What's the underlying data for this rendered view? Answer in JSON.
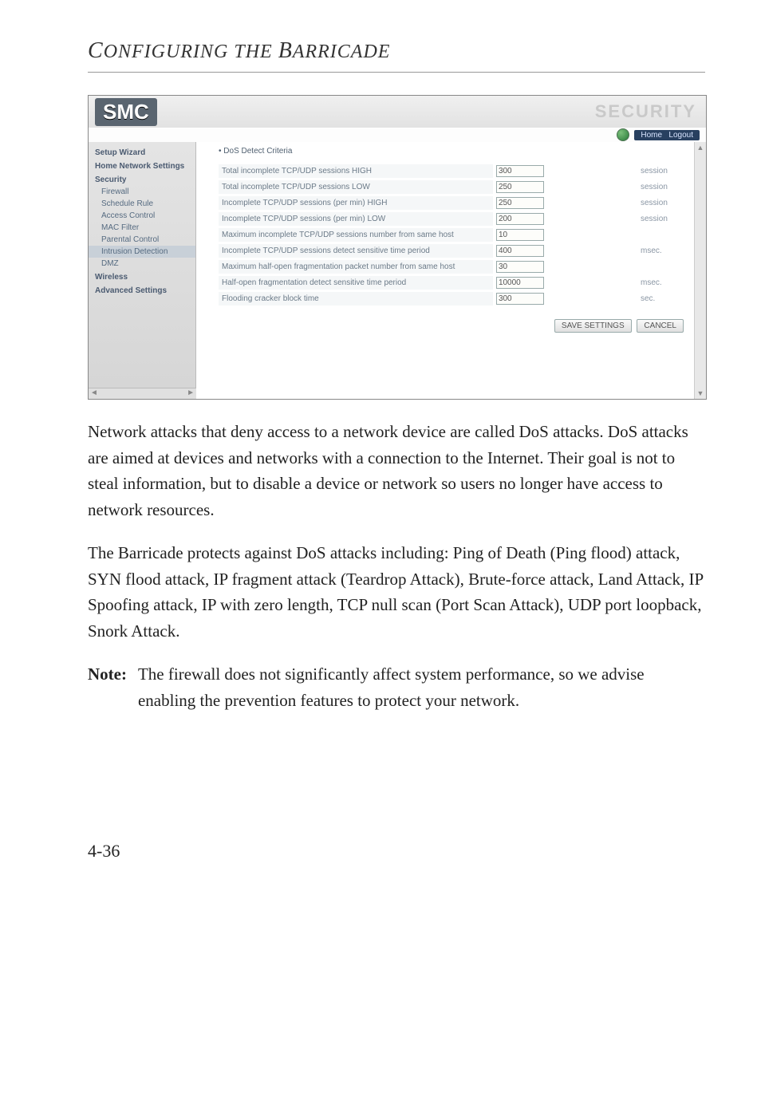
{
  "running_head": {
    "c1": "C",
    "w1": "ONFIGURING",
    "sp": " THE ",
    "c2": "B",
    "w2": "ARRICADE"
  },
  "screenshot": {
    "logo": "SMC",
    "security_word": "SECURITY",
    "nav_home": "Home",
    "nav_logout": "Logout",
    "sidebar": {
      "setup_wizard": "Setup Wizard",
      "home_network": "Home Network Settings",
      "security": "Security",
      "firewall": "Firewall",
      "schedule_rule": "Schedule Rule",
      "access_control": "Access Control",
      "mac_filter": "MAC Filter",
      "parental_control": "Parental Control",
      "intrusion_detection": "Intrusion Detection",
      "dmz": "DMZ",
      "wireless": "Wireless",
      "advanced_settings": "Advanced Settings"
    },
    "main_heading": "DoS Detect Criteria",
    "rows": [
      {
        "label": "Total incomplete TCP/UDP sessions HIGH",
        "value": "300",
        "unit": "session"
      },
      {
        "label": "Total incomplete TCP/UDP sessions LOW",
        "value": "250",
        "unit": "session"
      },
      {
        "label": "Incomplete TCP/UDP sessions (per min) HIGH",
        "value": "250",
        "unit": "session"
      },
      {
        "label": "Incomplete TCP/UDP sessions (per min) LOW",
        "value": "200",
        "unit": "session"
      },
      {
        "label": "Maximum incomplete TCP/UDP sessions number from same host",
        "value": "10",
        "unit": ""
      },
      {
        "label": "Incomplete TCP/UDP sessions detect sensitive time period",
        "value": "400",
        "unit": "msec."
      },
      {
        "label": "Maximum half-open fragmentation packet number from same host",
        "value": "30",
        "unit": ""
      },
      {
        "label": "Half-open fragmentation detect sensitive time period",
        "value": "10000",
        "unit": "msec."
      },
      {
        "label": "Flooding cracker block time",
        "value": "300",
        "unit": "sec."
      }
    ],
    "save_button": "SAVE SETTINGS",
    "cancel_button": "CANCEL"
  },
  "para1": "Network attacks that deny access to a network device are called DoS attacks. DoS attacks are aimed at devices and networks with a connection to the Internet. Their goal is not to steal information, but to disable a device or network so users no longer have access to network resources.",
  "para2": "The Barricade protects against DoS attacks including: Ping of Death (Ping flood) attack, SYN flood attack, IP fragment attack (Teardrop Attack), Brute-force attack, Land Attack, IP Spoofing attack, IP with zero length, TCP null scan (Port Scan Attack), UDP port loopback, Snork Attack.",
  "note_label": "Note:",
  "note_body": "The firewall does not significantly affect system performance, so we advise enabling the prevention features to protect your network.",
  "page_number": "4-36"
}
